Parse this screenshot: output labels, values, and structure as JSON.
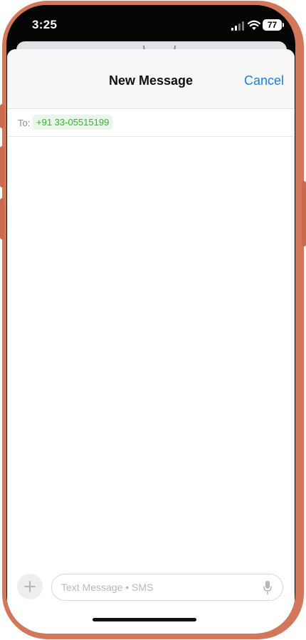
{
  "status_bar": {
    "time": "3:25",
    "battery": "77"
  },
  "compose": {
    "title": "New Message",
    "cancel": "Cancel",
    "to_label": "To:",
    "recipient": "+91 33-05515199",
    "placeholder": "Text Message • SMS"
  },
  "icons": [
    "cellular-signal-icon",
    "wifi-icon",
    "battery-icon",
    "add-attachment-icon",
    "microphone-icon"
  ],
  "colors": {
    "accent": "#1a7fe0",
    "recipient": "#2fb52f",
    "frame": "#d2775a"
  }
}
